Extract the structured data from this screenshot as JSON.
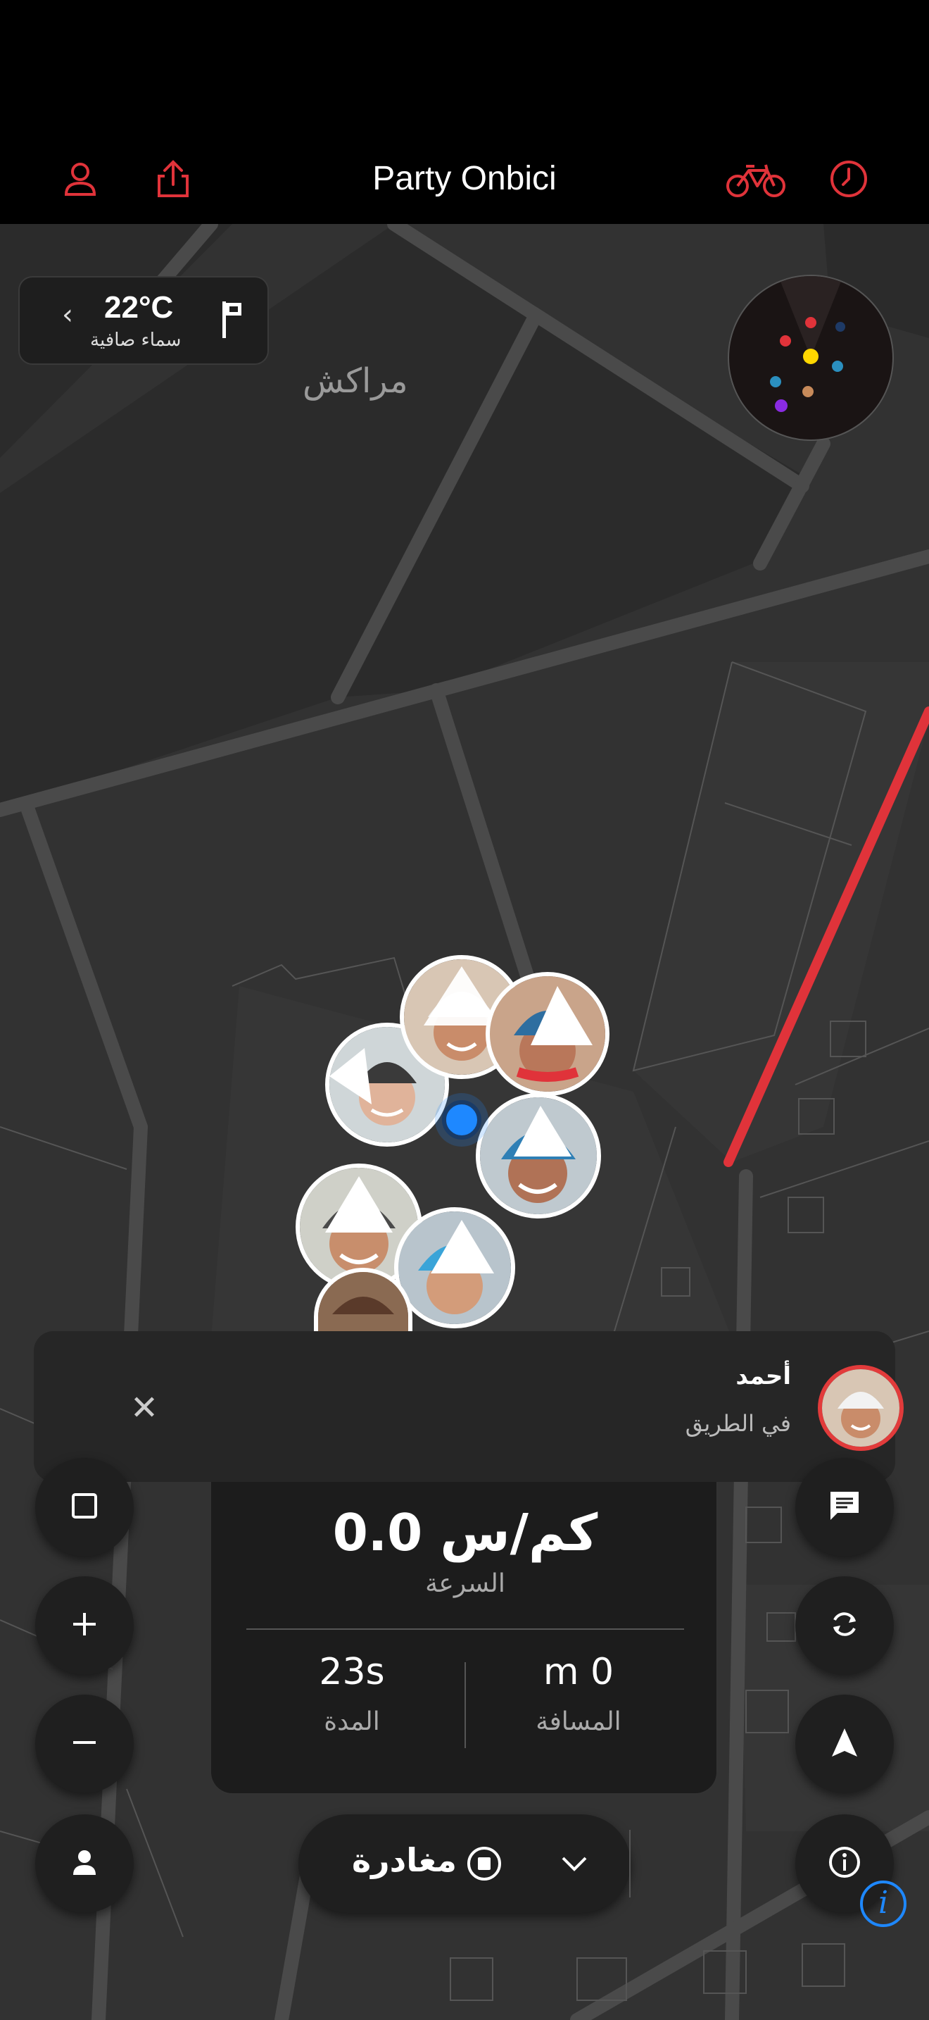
{
  "header": {
    "title": "Party Onbici",
    "icons": [
      "profile-icon",
      "share-icon",
      "bike-icon",
      "clock-icon"
    ],
    "accent_color": "#e0333a"
  },
  "weather": {
    "temperature": "22°C",
    "description": "سماء صافية"
  },
  "map": {
    "city_label": "مراكش",
    "route_color": "#e0333a"
  },
  "radar": {
    "dot_colors": [
      "#e0333a",
      "#ffd700",
      "#1e6aa8",
      "#2b8fbf",
      "#c78a5a",
      "#8a2be2"
    ]
  },
  "rider": {
    "name": "أحمد",
    "status": "في الطريق"
  },
  "stats": {
    "speed_value": "0.0 كم/س",
    "speed_label": "السرعة",
    "distance_value": "m 0",
    "distance_label": "المسافة",
    "duration_value": "23s",
    "duration_label": "المدة"
  },
  "actions": {
    "leave_label": "مغادرة"
  }
}
